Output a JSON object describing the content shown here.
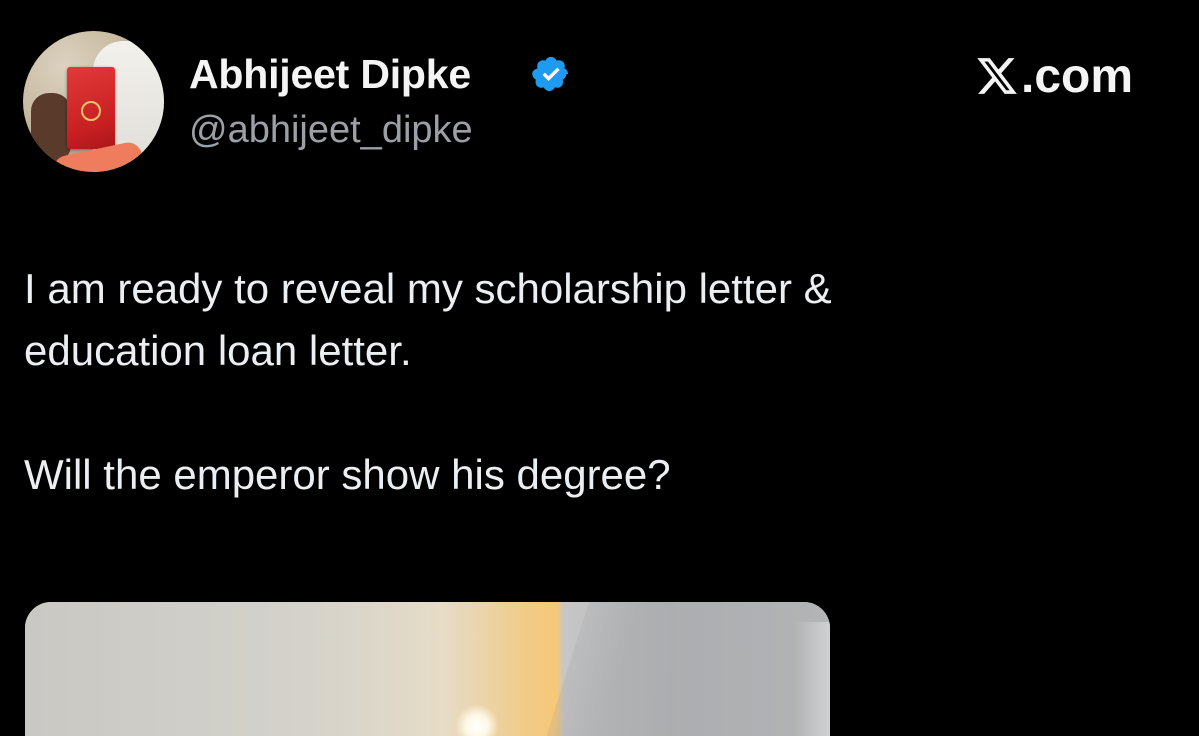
{
  "author": {
    "display_name": "Abhijeet Dipke",
    "handle": "@abhijeet_dipke",
    "verified": true,
    "verified_badge_color": "#1d9bf0",
    "avatar_icon": "profile-photo"
  },
  "watermark": {
    "site": ".com",
    "logo_icon": "x-logo-icon"
  },
  "post": {
    "line_1": "I am ready to reveal my scholarship letter &",
    "line_2": "education loan letter.",
    "line_3": "Will the emperor show his degree?"
  },
  "media": {
    "kind": "photo"
  },
  "colors": {
    "background": "#000000",
    "text_primary": "#e7e9ea",
    "text_secondary": "#9aa0a6",
    "accent": "#1d9bf0"
  }
}
